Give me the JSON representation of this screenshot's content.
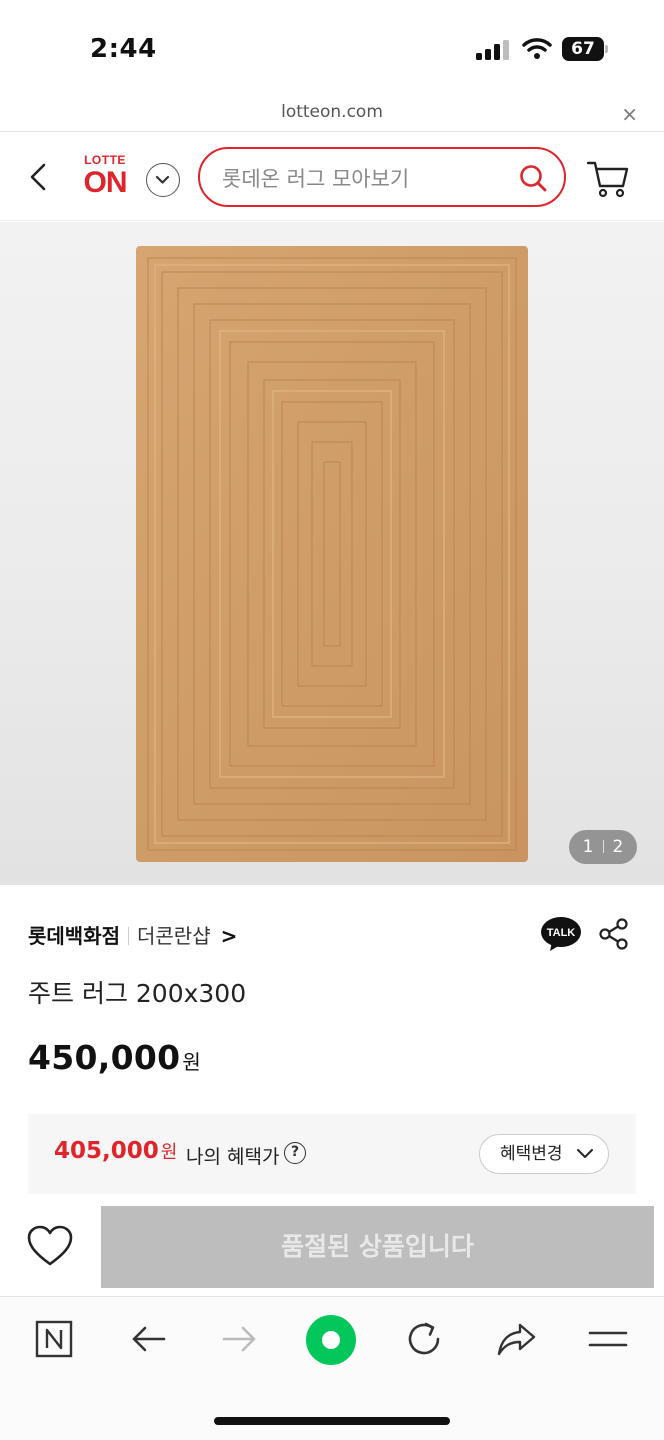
{
  "status_bar": {
    "time": "2:44",
    "battery": "67"
  },
  "browser": {
    "url": "lotteon.com",
    "close_symbol": "×"
  },
  "header": {
    "logo_top": "LOTTE",
    "logo_main": "ON",
    "search_placeholder": "롯데온 러그 모아보기"
  },
  "gallery": {
    "current": "1",
    "total": "2"
  },
  "product": {
    "seller": "롯데백화점",
    "shop": "더콘란샵",
    "shop_chevron": ">",
    "talk_label": "TALK",
    "title": "주트 러그 200x300",
    "price": "450,000",
    "currency": "원"
  },
  "benefit": {
    "price": "405,000",
    "currency": "원",
    "label": "나의 혜택가",
    "help": "?",
    "change_button": "혜택변경"
  },
  "purchase": {
    "soldout_label": "품절된 상품입니다"
  },
  "colors": {
    "brand_red": "#e0242b",
    "naver_green": "#03c75a",
    "soldout_gray": "#bdbdbd"
  }
}
